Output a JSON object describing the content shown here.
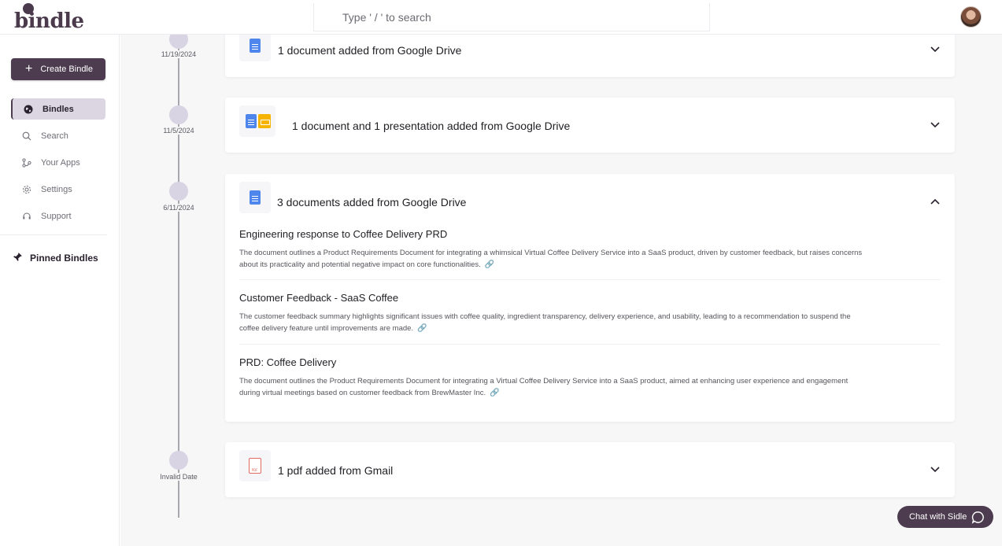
{
  "app": {
    "logo_text": "bindle"
  },
  "search": {
    "placeholder": "Type ' / ' to search"
  },
  "sidebar": {
    "create_label": "Create Bindle",
    "items": [
      {
        "label": "Bindles",
        "icon": "globe-icon",
        "active": true
      },
      {
        "label": "Search",
        "icon": "search-icon",
        "active": false
      },
      {
        "label": "Your Apps",
        "icon": "apps-icon",
        "active": false
      },
      {
        "label": "Settings",
        "icon": "gear-icon",
        "active": false
      },
      {
        "label": "Support",
        "icon": "headset-icon",
        "active": false
      }
    ],
    "pinned_label": "Pinned Bindles"
  },
  "timeline": {
    "dates": [
      "11/19/2024",
      "11/5/2024",
      "6/11/2024",
      "Invalid Date"
    ],
    "cards": [
      {
        "title": "1 document added from Google Drive",
        "icons": [
          "google-docs-icon"
        ],
        "expanded": false
      },
      {
        "title": "1 document and 1 presentation added from Google Drive",
        "icons": [
          "google-docs-icon",
          "google-slides-icon"
        ],
        "expanded": false
      },
      {
        "title": "3 documents added from Google Drive",
        "icons": [
          "google-docs-icon"
        ],
        "expanded": true,
        "documents": [
          {
            "title": "Engineering response to Coffee Delivery PRD",
            "line1": "The document outlines a Product Requirements Document for integrating a whimsical Virtual Coffee Delivery Service into a SaaS product, driven by customer feedback, but raises concerns",
            "line2": "about its practicality and potential negative impact on core functionalities."
          },
          {
            "title": "Customer Feedback - SaaS Coffee",
            "line1": "The customer feedback summary highlights significant issues with coffee quality, ingredient transparency, delivery experience, and usability, leading to a recommendation to suspend the",
            "line2": "coffee delivery feature until improvements are made."
          },
          {
            "title": "PRD: Coffee Delivery",
            "line1": "The document outlines the Product Requirements Document for integrating a Virtual Coffee Delivery Service into a SaaS product, aimed at enhancing user experience and engagement",
            "line2": "during virtual meetings based on customer feedback from BrewMaster Inc."
          }
        ]
      },
      {
        "title": "1 pdf added from Gmail",
        "icons": [
          "pdf-icon"
        ],
        "expanded": false
      }
    ]
  },
  "chat": {
    "label": "Chat with Sidle"
  },
  "colors": {
    "brand": "#4d3c4f",
    "active_nav_bg": "#dcd6e3",
    "timeline_node": "#d8d4e3"
  }
}
